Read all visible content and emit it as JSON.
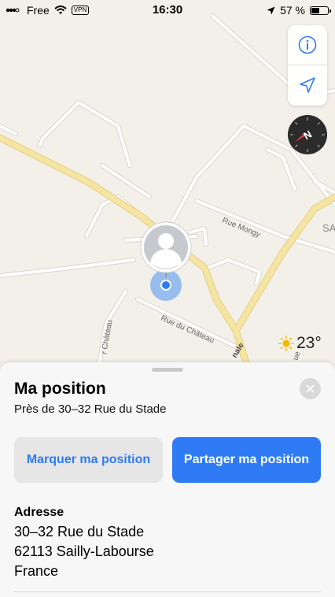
{
  "status_bar": {
    "carrier": "Free",
    "vpn": "VPN",
    "time": "16:30",
    "battery_text": "57 %",
    "battery_level": 0.57
  },
  "map": {
    "street_labels": [
      "Rue Mongy",
      "Rue du Château",
      "r Château",
      "nale",
      "SA",
      "ue"
    ],
    "weather": {
      "icon": "sun-icon",
      "temperature": "23°"
    },
    "controls": {
      "info_icon": "info-icon",
      "location_icon": "location-arrow-icon",
      "compass_letter": "N"
    }
  },
  "sheet": {
    "title": "Ma position",
    "subtitle": "Près de 30–32 Rue du Stade",
    "mark_button": "Marquer ma position",
    "share_button": "Partager ma position",
    "address": {
      "label": "Adresse",
      "line1": "30–32 Rue du Stade",
      "line2": "62113 Sailly-Labourse",
      "line3": "France"
    }
  },
  "colors": {
    "accent": "#2f7bf5",
    "map_background": "#f3f0e9",
    "main_road": "#f3df98",
    "minor_road": "#ffffff"
  }
}
